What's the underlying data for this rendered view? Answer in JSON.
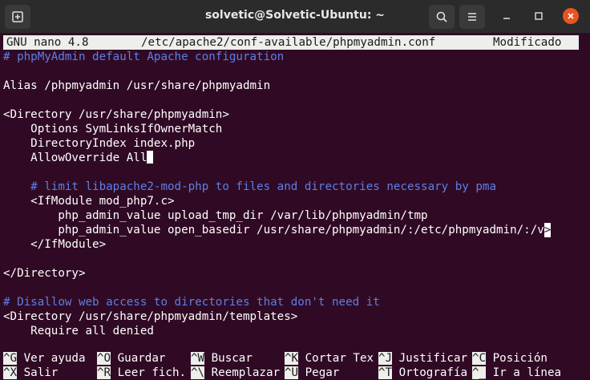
{
  "window": {
    "title": "solvetic@Solvetic-Ubuntu: ~"
  },
  "nano": {
    "version": "GNU nano 4.8",
    "file": "/etc/apache2/conf-available/phpmyadmin.conf",
    "status": "Modificado"
  },
  "lines": [
    "# phpMyAdmin default Apache configuration",
    "",
    "Alias /phpmyadmin /usr/share/phpmyadmin",
    "",
    "<Directory /usr/share/phpmyadmin>",
    "    Options SymLinksIfOwnerMatch",
    "    DirectoryIndex index.php",
    "    AllowOverride All",
    "",
    "    # limit libapache2-mod-php to files and directories necessary by pma",
    "    <IfModule mod_php7.c>",
    "        php_admin_value upload_tmp_dir /var/lib/phpmyadmin/tmp",
    "        php_admin_value open_basedir /usr/share/phpmyadmin/:/etc/phpmyadmin/:/v",
    "    </IfModule>",
    "",
    "</Directory>",
    "",
    "# Disallow web access to directories that don't need it",
    "<Directory /usr/share/phpmyadmin/templates>",
    "    Require all denied"
  ],
  "truncation_marker": ">",
  "shortcuts_row1": [
    {
      "key": "^G",
      "label": " Ver ayuda"
    },
    {
      "key": "^O",
      "label": " Guardar"
    },
    {
      "key": "^W",
      "label": " Buscar"
    },
    {
      "key": "^K",
      "label": " Cortar Tex"
    },
    {
      "key": "^J",
      "label": " Justificar"
    },
    {
      "key": "^C",
      "label": " Posición"
    }
  ],
  "shortcuts_row2": [
    {
      "key": "^X",
      "label": " Salir"
    },
    {
      "key": "^R",
      "label": " Leer fich."
    },
    {
      "key": "^\\",
      "label": " Reemplazar"
    },
    {
      "key": "^U",
      "label": " Pegar"
    },
    {
      "key": "^T",
      "label": " Ortografía"
    },
    {
      "key": "^_",
      "label": " Ir a línea"
    }
  ],
  "colors": {
    "background": "#300a24",
    "comment": "#5c7fe8",
    "header_bg": "#eeeeec",
    "close_button": "#e95420"
  },
  "icons": [
    "new-tab-icon",
    "search-icon",
    "hamburger-menu-icon",
    "minimize-icon",
    "maximize-icon",
    "close-icon"
  ]
}
